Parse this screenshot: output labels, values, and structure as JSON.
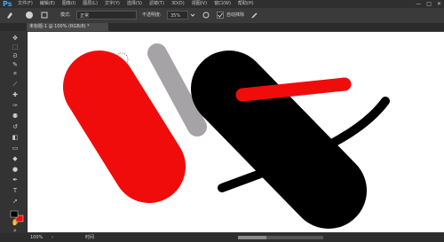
{
  "app": {
    "logo_text": "Ps"
  },
  "menu": [
    "文件(F)",
    "编辑(E)",
    "图像(I)",
    "图层(L)",
    "文字(Y)",
    "选择(S)",
    "滤镜(T)",
    "3D(D)",
    "视图(V)",
    "窗口(W)",
    "帮助(H)"
  ],
  "window_controls": [
    "—",
    "□",
    "✕"
  ],
  "options_bar": {
    "mode_label": "模式:",
    "mode_value": "正常",
    "opacity_label": "不透明度:",
    "opacity_value": "35%",
    "checkbox_label": "自动抹除"
  },
  "document_tab": {
    "title": "未标题-1 @ 100% (RGB/8) *"
  },
  "status_bar": {
    "zoom": "100%",
    "arrow": "›",
    "extra": "时间"
  },
  "colors": {
    "red": "#f10c0c",
    "grey": "#a6a3a6",
    "black": "#000000"
  },
  "icons": [
    "move-icon",
    "marquee-icon",
    "lasso-icon",
    "quick-select-icon",
    "crop-icon",
    "eyedropper-icon",
    "heal-icon",
    "brush-icon",
    "clone-icon",
    "history-brush-icon",
    "eraser-icon",
    "gradient-icon",
    "blur-icon",
    "dodge-icon",
    "pen-icon",
    "type-icon",
    "path-select-icon",
    "shape-icon",
    "hand-icon",
    "zoom-icon"
  ]
}
